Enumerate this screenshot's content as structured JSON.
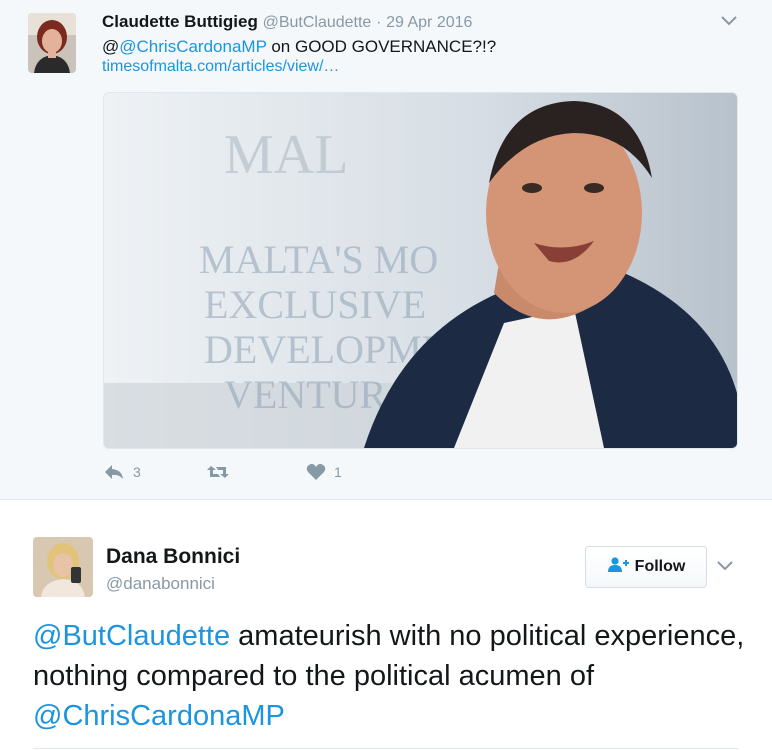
{
  "parent_tweet": {
    "author_name": "Claudette Buttigieg",
    "author_handle": "@ButClaudette",
    "separator": "·",
    "date": "29 Apr 2016",
    "text_prefix": "@",
    "mention": "@ChrisCardonaMP",
    "text_suffix": " on GOOD GOVERNANCE?!?",
    "link": "timesofmalta.com/articles/view/…",
    "actions": {
      "reply_count": "3",
      "retweet_count": "",
      "like_count": "1"
    }
  },
  "reply_tweet": {
    "author_name": "Dana Bonnici",
    "author_handle": "@danabonnici",
    "follow_label": "Follow",
    "mention_1": "@ButClaudette",
    "text_mid": " amateurish with no political experience, nothing compared to the political acumen of ",
    "mention_2": "@ChrisCardonaMP"
  },
  "icons": {
    "reply": "reply-icon",
    "retweet": "retweet-icon",
    "like": "heart-icon",
    "follow": "add-user-icon",
    "caret": "chevron-down-icon"
  },
  "colors": {
    "link_blue": "#1b95e0",
    "muted_gray": "#8899a6",
    "parent_background": "#f5f8fa"
  }
}
